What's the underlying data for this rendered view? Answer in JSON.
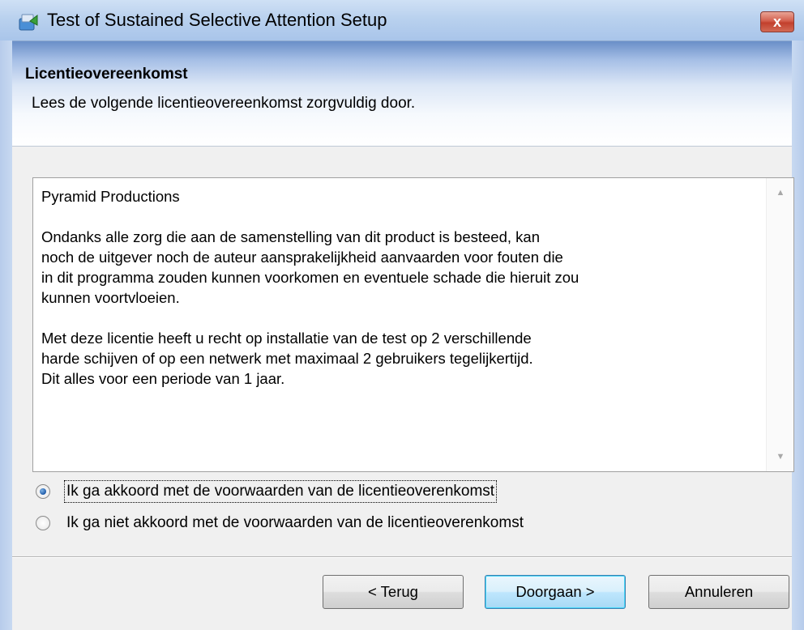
{
  "window": {
    "title": "Test of Sustained Selective Attention Setup",
    "close_symbol": "x"
  },
  "header": {
    "title": "Licentieovereenkomst",
    "subtitle": "Lees de volgende licentieovereenkomst zorgvuldig door."
  },
  "license": {
    "paragraphs": [
      "Pyramid Productions",
      "Ondanks alle zorg die aan de samenstelling van dit product is besteed, kan\nnoch de uitgever noch de auteur aansprakelijkheid aanvaarden voor fouten die\nin dit programma zouden kunnen voorkomen en eventuele schade die hieruit zou\nkunnen voortvloeien.",
      "Met deze licentie heeft u recht op installatie van de test op 2 verschillende\nharde schijven of op een netwerk met maximaal 2 gebruikers tegelijkertijd.\nDit alles voor een periode van 1 jaar."
    ]
  },
  "options": {
    "accept_label": "Ik ga akkoord met de voorwaarden van de licentieoverenkomst",
    "decline_label": "Ik ga niet akkoord met de voorwaarden van de licentieoverenkomst",
    "selected": "accept"
  },
  "buttons": {
    "back_label": "< Terug",
    "next_label": "Doorgaan >",
    "cancel_label": "Annuleren"
  },
  "icons": {
    "title": "setup-installer-icon",
    "close": "close-icon",
    "scroll_up": "scroll-up-arrow-icon",
    "scroll_down": "scroll-down-arrow-icon"
  },
  "colors": {
    "accent": "#3c7fb1",
    "close_red": "#c2402d"
  }
}
